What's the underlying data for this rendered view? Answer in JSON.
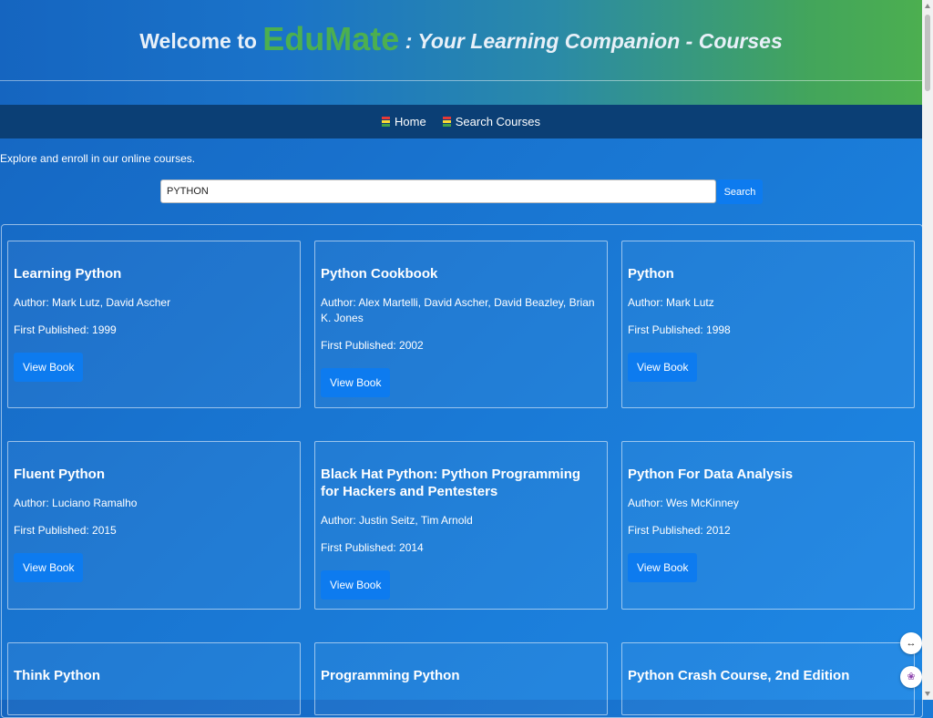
{
  "header": {
    "welcome": "Welcome to",
    "brand": "EduMate",
    "tagline": ": Your Learning Companion - Courses"
  },
  "nav": {
    "items": [
      {
        "label": "Home",
        "icon": "books-icon"
      },
      {
        "label": "Search Courses",
        "icon": "books-icon"
      }
    ]
  },
  "intro": "Explore and enroll in our online courses.",
  "search": {
    "value": "PYTHON",
    "button": "Search"
  },
  "books": [
    {
      "title": "Learning Python",
      "author": "Author: Mark Lutz, David Ascher",
      "published": "First Published: 1999",
      "button": "View Book"
    },
    {
      "title": "Python Cookbook",
      "author": "Author: Alex Martelli, David Ascher, David Beazley, Brian K. Jones",
      "published": "First Published: 2002",
      "button": "View Book"
    },
    {
      "title": "Python",
      "author": "Author: Mark Lutz",
      "published": "First Published: 1998",
      "button": "View Book"
    },
    {
      "title": "Fluent Python",
      "author": "Author: Luciano Ramalho",
      "published": "First Published: 2015",
      "button": "View Book"
    },
    {
      "title": "Black Hat Python: Python Programming for Hackers and Pentesters",
      "author": "Author: Justin Seitz, Tim Arnold",
      "published": "First Published: 2014",
      "button": "View Book"
    },
    {
      "title": "Python For Data Analysis",
      "author": "Author: Wes McKinney",
      "published": "First Published: 2012",
      "button": "View Book"
    },
    {
      "title": "Think Python"
    },
    {
      "title": "Programming Python"
    },
    {
      "title": "Python Crash Course, 2nd Edition"
    }
  ],
  "colors": {
    "brand": "#4caf50",
    "accent": "#0d7bef",
    "nav_bg": "#0b3f75"
  }
}
